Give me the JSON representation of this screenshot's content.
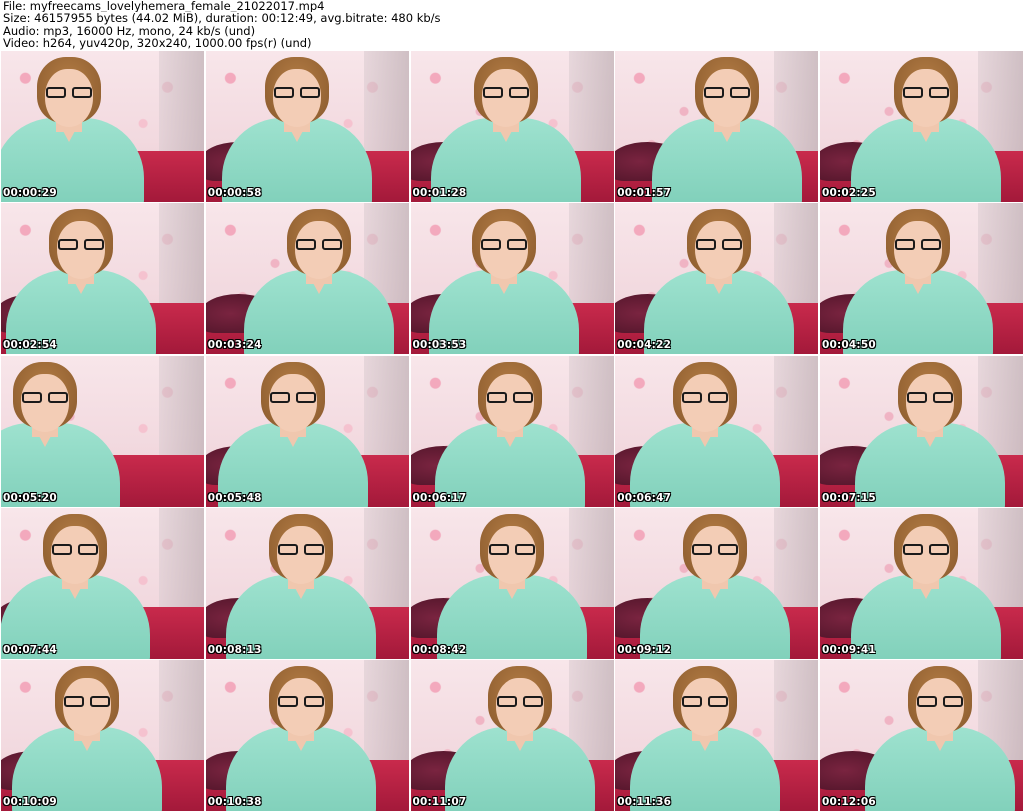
{
  "header": {
    "line1": "File: myfreecams_lovelyhemera_female_21022017.mp4",
    "line2": "Size: 46157955 bytes (44.02 MiB), duration: 00:12:49, avg.bitrate: 480 kb/s",
    "line3": "Audio: mp3, 16000 Hz, mono, 24 kb/s (und)",
    "line4": "Video: h264, yuv420p, 320x240, 1000.00 fps(r) (und)"
  },
  "thumbnails": [
    {
      "timestamp": "00:00:29"
    },
    {
      "timestamp": "00:00:58"
    },
    {
      "timestamp": "00:01:28"
    },
    {
      "timestamp": "00:01:57"
    },
    {
      "timestamp": "00:02:25"
    },
    {
      "timestamp": "00:02:54"
    },
    {
      "timestamp": "00:03:24"
    },
    {
      "timestamp": "00:03:53"
    },
    {
      "timestamp": "00:04:22"
    },
    {
      "timestamp": "00:04:50"
    },
    {
      "timestamp": "00:05:20"
    },
    {
      "timestamp": "00:05:48"
    },
    {
      "timestamp": "00:06:17"
    },
    {
      "timestamp": "00:06:47"
    },
    {
      "timestamp": "00:07:15"
    },
    {
      "timestamp": "00:07:44"
    },
    {
      "timestamp": "00:08:13"
    },
    {
      "timestamp": "00:08:42"
    },
    {
      "timestamp": "00:09:12"
    },
    {
      "timestamp": "00:09:41"
    },
    {
      "timestamp": "00:10:09"
    },
    {
      "timestamp": "00:10:38"
    },
    {
      "timestamp": "00:11:07"
    },
    {
      "timestamp": "00:11:36"
    },
    {
      "timestamp": "00:12:06"
    }
  ]
}
